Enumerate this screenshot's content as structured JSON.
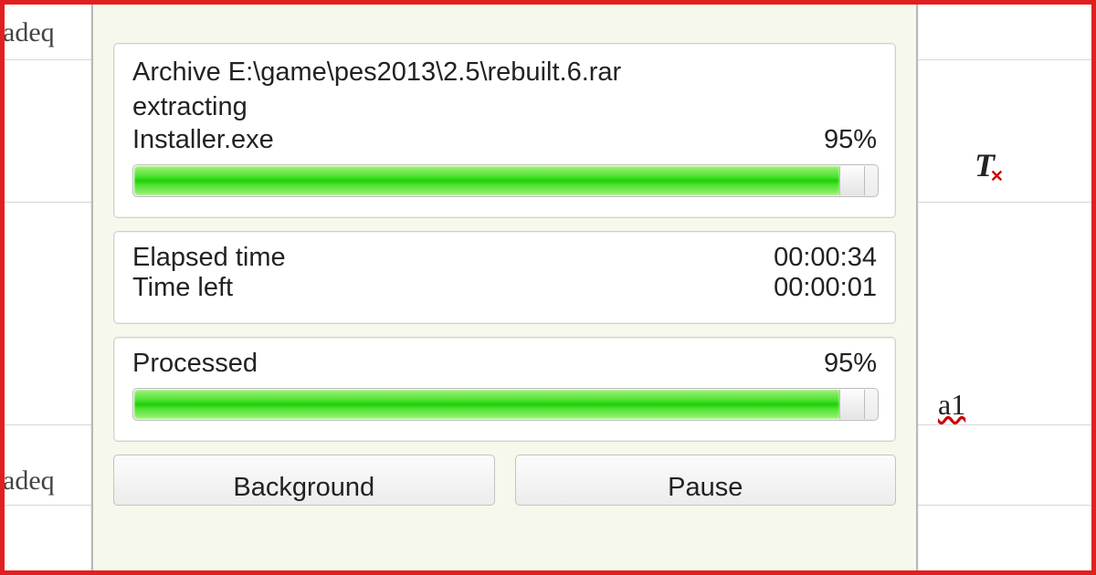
{
  "background": {
    "stub_left_1": "adeq",
    "stub_left_2": "adeq",
    "stub_right_a1": "a1"
  },
  "dialog": {
    "archive_label": "Archive",
    "archive_path": "E:\\game\\pes2013\\2.5\\rebuilt.6.rar",
    "status": "extracting",
    "current_file": "Installer.exe",
    "current_percent_text": "95%",
    "current_percent": 95,
    "elapsed_label": "Elapsed time",
    "elapsed_value": "00:00:34",
    "left_label": "Time left",
    "left_value": "00:00:01",
    "processed_label": "Processed",
    "processed_percent_text": "95%",
    "processed_percent": 95,
    "buttons": {
      "background": "Background",
      "pause": "Pause"
    }
  }
}
